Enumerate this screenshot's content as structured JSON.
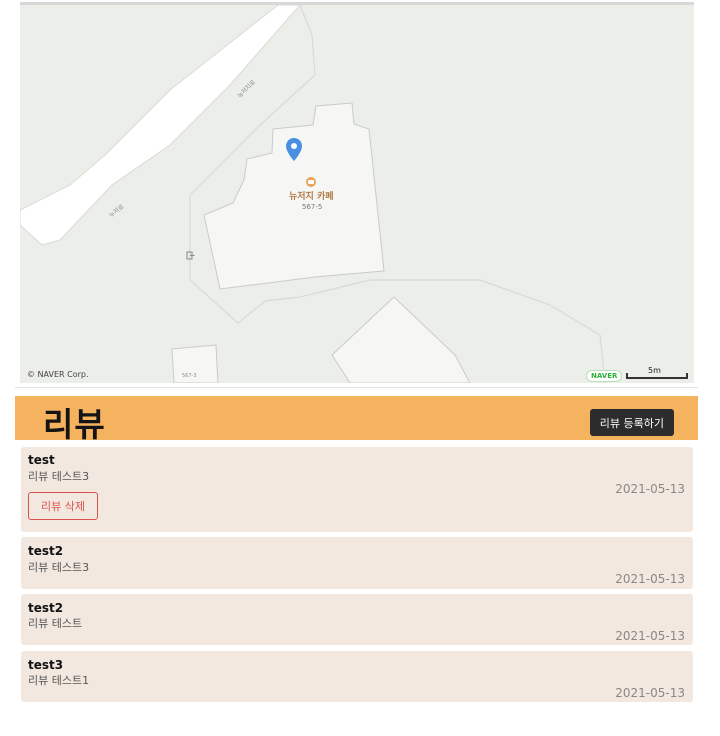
{
  "map": {
    "place_label": "뉴저지 카페",
    "place_address": "567-5",
    "road_label_top": "뉴저지로",
    "road_label_left": "누저로",
    "small_building_label": "567-3",
    "copyright": "© NAVER Corp.",
    "logo": "NAVER",
    "scale": "5m",
    "marker_icon": "map-pin-icon",
    "cafe_icon": "cafe-icon",
    "entrance_icon": "entrance-icon"
  },
  "header": {
    "title": "리뷰",
    "add_label": "리뷰 등록하기"
  },
  "reviews": [
    {
      "title": "test",
      "body": "리뷰 테스트3",
      "date": "2021-05-13",
      "delete_label": "리뷰 삭제"
    },
    {
      "title": "test2",
      "body": "리뷰 테스트3",
      "date": "2021-05-13"
    },
    {
      "title": "test2",
      "body": "리뷰 테스트",
      "date": "2021-05-13"
    },
    {
      "title": "test3",
      "body": "리뷰 테스트1",
      "date": "2021-05-13"
    }
  ],
  "colors": {
    "header_bg": "#f5b25f",
    "card_bg": "#f3e8df",
    "delete_accent": "#d9534f",
    "marker": "#4a90e2"
  }
}
